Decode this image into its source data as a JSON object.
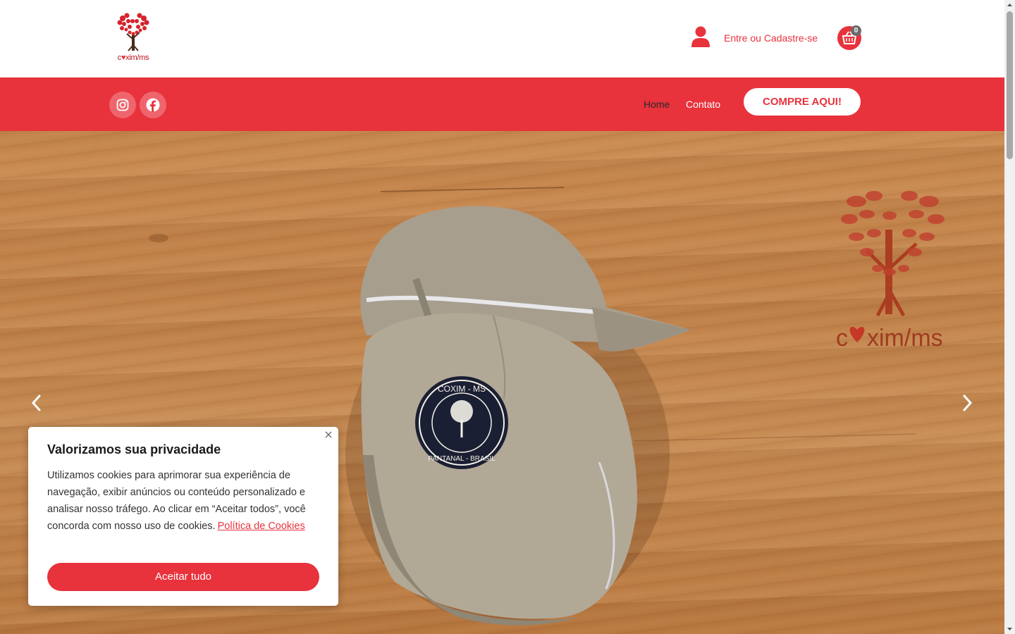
{
  "header": {
    "logo_text_c": "c",
    "logo_text_heart": "♥",
    "logo_text_rest": "xim/ms",
    "login_label": "Entre ou Cadastre-se",
    "cart_count": "0"
  },
  "nav": {
    "social": [
      "instagram-icon",
      "facebook-icon"
    ],
    "home_label": "Home",
    "contact_label": "Contato",
    "cta_label": "COMPRE AQUI!"
  },
  "hero": {
    "patch_top_text": "COXIM - MS",
    "patch_bottom_text": "PANTANAL - BRASIL",
    "brand_c": "c",
    "brand_rest": "xim/ms"
  },
  "cookie": {
    "title": "Valorizamos sua privacidade",
    "text": "Utilizamos cookies para aprimorar sua experiência de navegação, exibir anúncios ou conteúdo personalizado e analisar nosso tráfego. Ao clicar em “Aceitar todos”, você concorda com nosso uso de cookies.",
    "policy_link": "Política de Cookies",
    "accept_label": "Aceitar tudo"
  },
  "colors": {
    "brand_red": "#e8323c",
    "wood": "#c08048"
  }
}
